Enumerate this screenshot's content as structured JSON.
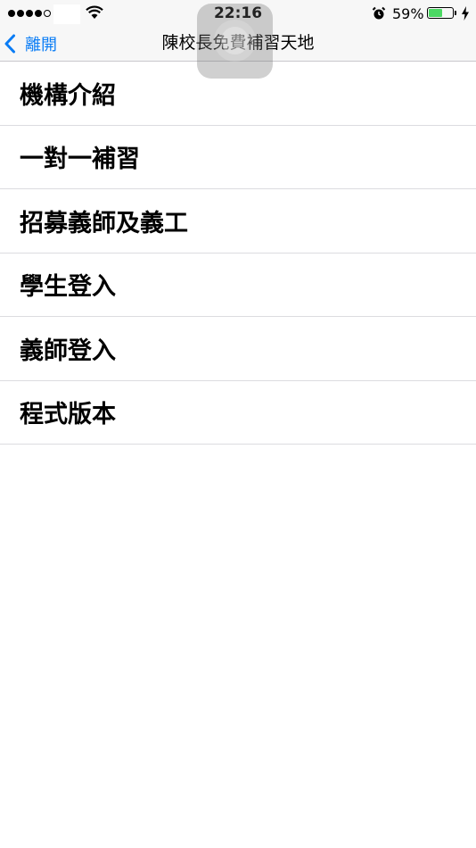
{
  "status_bar": {
    "signal_bars": 5,
    "signal_filled": 4,
    "time": "22:16",
    "battery_percent": "59%",
    "battery_level": 0.59,
    "icons": [
      "wifi-icon",
      "alarm-icon",
      "battery-icon",
      "charging-bolt-icon"
    ]
  },
  "nav": {
    "back_label": "離開",
    "title": "陳校長免費補習天地",
    "icons": [
      "chevron-left-icon"
    ]
  },
  "menu": {
    "items": [
      {
        "label": "機構介紹"
      },
      {
        "label": "一對一補習"
      },
      {
        "label": "招募義師及義工"
      },
      {
        "label": "學生登入"
      },
      {
        "label": "義師登入"
      },
      {
        "label": "程式版本"
      }
    ]
  },
  "colors": {
    "accent": "#0a7cf5",
    "battery": "#4cd964",
    "bar_background": "#f7f7f7",
    "separator": "#dcdce0"
  }
}
